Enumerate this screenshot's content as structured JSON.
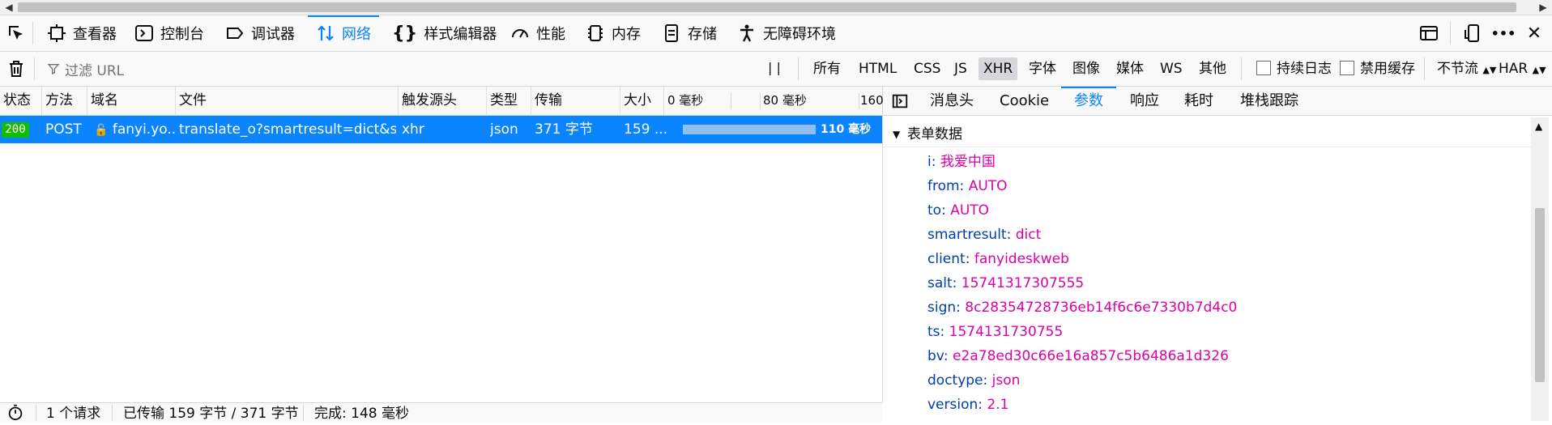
{
  "toolbar": {
    "tabs": [
      {
        "label": "查看器",
        "icon": "inspector-icon"
      },
      {
        "label": "控制台",
        "icon": "console-icon"
      },
      {
        "label": "调试器",
        "icon": "debugger-icon"
      },
      {
        "label": "网络",
        "icon": "network-icon",
        "selected": true
      },
      {
        "label": "样式编辑器",
        "icon": "style-editor-icon"
      },
      {
        "label": "性能",
        "icon": "performance-icon"
      },
      {
        "label": "内存",
        "icon": "memory-icon"
      },
      {
        "label": "存储",
        "icon": "storage-icon"
      },
      {
        "label": "无障碍环境",
        "icon": "accessibility-icon"
      }
    ],
    "more_label": "•••",
    "close_label": "✕"
  },
  "filter": {
    "placeholder": "过滤 URL",
    "types": [
      "所有",
      "HTML",
      "CSS",
      "JS",
      "XHR",
      "字体",
      "图像",
      "媒体",
      "WS",
      "其他"
    ],
    "active_type": "XHR",
    "persist_logs_label": "持续日志",
    "disable_cache_label": "禁用缓存",
    "throttle_label": "不节流",
    "har_label": "HAR"
  },
  "table": {
    "headers": [
      "状态",
      "方法",
      "域名",
      "文件",
      "触发源头",
      "类型",
      "传输",
      "大小"
    ],
    "timeline_ticks": [
      "0 毫秒",
      "80 毫秒",
      "160"
    ],
    "row": {
      "status": "200",
      "method": "POST",
      "domain": "fanyi.yo...",
      "file": "translate_o?smartresult=dict&s...",
      "cause": "xhr",
      "type": "json",
      "transferred": "371 字节",
      "size": "159 ...",
      "timing": "110 毫秒"
    }
  },
  "statusbar": {
    "requests": "1 个请求",
    "transferred": "已传输 159 字节 / 371 字节",
    "finish": "完成: 148 毫秒"
  },
  "details": {
    "tabs": [
      "消息头",
      "Cookie",
      "参数",
      "响应",
      "耗时",
      "堆栈跟踪"
    ],
    "active_tab": "参数",
    "section_title": "表单数据",
    "params": [
      {
        "key": "i:",
        "value": "我爱中国"
      },
      {
        "key": "from:",
        "value": "AUTO"
      },
      {
        "key": "to:",
        "value": "AUTO"
      },
      {
        "key": "smartresult:",
        "value": "dict"
      },
      {
        "key": "client:",
        "value": "fanyideskweb"
      },
      {
        "key": "salt:",
        "value": "15741317307555"
      },
      {
        "key": "sign:",
        "value": "8c28354728736eb14f6c6e7330b7d4c0"
      },
      {
        "key": "ts:",
        "value": "1574131730755"
      },
      {
        "key": "bv:",
        "value": "e2a78ed30c66e16a857c5b6486a1d326"
      },
      {
        "key": "doctype:",
        "value": "json"
      },
      {
        "key": "version:",
        "value": "2.1"
      }
    ]
  },
  "colors": {
    "accent": "#0a84ff",
    "status_ok": "#12bc00",
    "param_key": "#003eaa",
    "param_value": "#dd00a9"
  }
}
